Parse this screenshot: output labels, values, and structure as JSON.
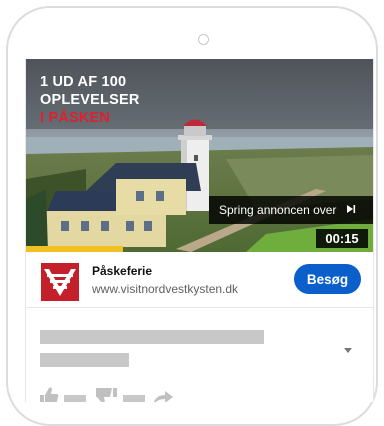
{
  "ad": {
    "headline_lines": [
      "1 UD AF 100",
      "OPLEVELSER"
    ],
    "headline_accent": "I PÅSKEN",
    "skip_label": "Spring annoncen over",
    "skip_icon": "skip-next-icon",
    "duration": "00:15",
    "progress": 0.28,
    "advertiser_title": "Påskeferie",
    "advertiser_url": "www.visitnordvestkysten.dk",
    "visit_label": "Besøg",
    "accent_color": "#e0202e",
    "button_color": "#0b5fcb",
    "progress_color": "#f2c022"
  },
  "actions": {
    "like_icon": "thumbs-up-icon",
    "dislike_icon": "thumbs-down-icon",
    "share_icon": "share-icon",
    "expand_icon": "chevron-down-icon"
  }
}
